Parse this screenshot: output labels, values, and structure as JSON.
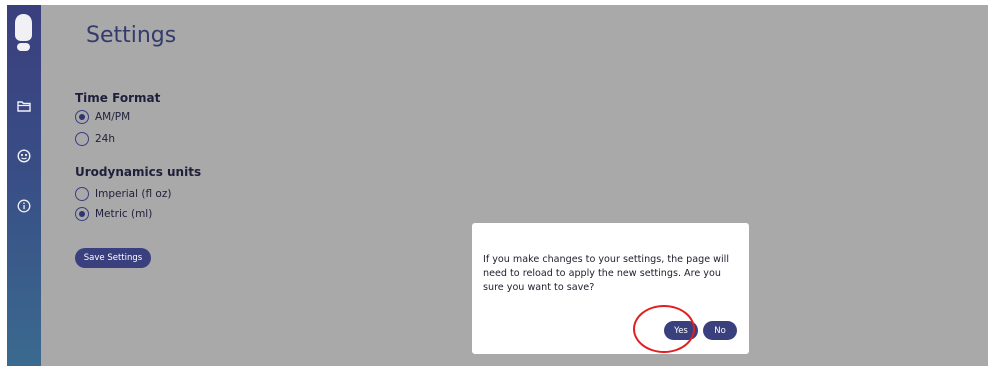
{
  "header": {
    "title": "Settings"
  },
  "sidebar": {
    "icons": [
      "folder-icon",
      "face-icon",
      "info-icon"
    ]
  },
  "settings": {
    "time_format": {
      "title": "Time Format",
      "options": [
        {
          "label": "AM/PM",
          "selected": true
        },
        {
          "label": "24h",
          "selected": false
        }
      ]
    },
    "units": {
      "title": "Urodynamics units",
      "options": [
        {
          "label": "Imperial (fl oz)",
          "selected": false
        },
        {
          "label": "Metric (ml)",
          "selected": true
        }
      ]
    },
    "save_label": "Save Settings"
  },
  "dialog": {
    "message": "If you make changes to your settings, the page will need to reload to apply the new settings. Are you sure you want to save?",
    "yes_label": "Yes",
    "no_label": "No"
  },
  "colors": {
    "accent": "#3a3f7e",
    "overlay": "#a9a9a9",
    "annotation": "#e02020"
  }
}
